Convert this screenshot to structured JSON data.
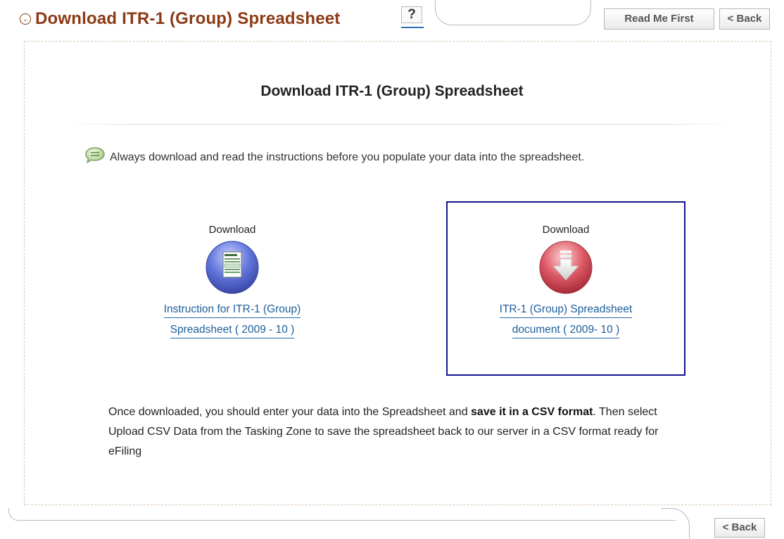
{
  "header": {
    "title": "Download ITR-1 (Group) Spreadsheet",
    "help_label": "?",
    "read_me_label": "Read Me First",
    "back_label": "< Back"
  },
  "main": {
    "heading": "Download ITR-1 (Group) Spreadsheet",
    "note": "Always download and read the instructions before you populate your data into the spreadsheet."
  },
  "cards": [
    {
      "label": "Download",
      "link_line1": "Instruction for ITR-1 (Group)",
      "link_line2": "Spreadsheet ( 2009 - 10 )",
      "icon": "document-icon"
    },
    {
      "label": "Download",
      "link_line1": "ITR-1 (Group) Spreadsheet",
      "link_line2": "document ( 2009- 10 )",
      "icon": "download-arrow-icon"
    }
  ],
  "bottom": {
    "text_part1": "Once downloaded, you should enter your data into the Spreadsheet and ",
    "text_bold": "save it in a CSV format",
    "text_part2": ". Then select Upload CSV Data from the Tasking Zone to save the spreadsheet back to our server in a CSV format ready for eFiling",
    "back_label": "< Back"
  },
  "colors": {
    "title": "#8b3a15",
    "link": "#1e5e9a",
    "selected_border": "#14148c",
    "doc_icon": "#5a6fd0",
    "download_icon": "#d94a5a"
  }
}
